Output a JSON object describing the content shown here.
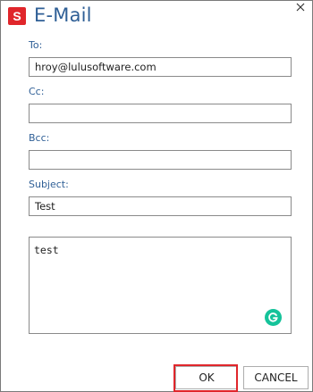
{
  "window": {
    "title": "E-Mail",
    "app_icon_letter": "S",
    "close_icon": "close-icon"
  },
  "form": {
    "to": {
      "label": "To:",
      "value": "hroy@lulusoftware.com"
    },
    "cc": {
      "label": "Cc:",
      "value": ""
    },
    "bcc": {
      "label": "Bcc:",
      "value": ""
    },
    "subject": {
      "label": "Subject:",
      "value": "Test"
    },
    "body": {
      "value": "test"
    }
  },
  "buttons": {
    "ok_label": "OK",
    "cancel_label": "CANCEL"
  },
  "colors": {
    "accent": "#2f5f96",
    "brand_red": "#e0262b",
    "grammarly_green": "#15c39a"
  }
}
